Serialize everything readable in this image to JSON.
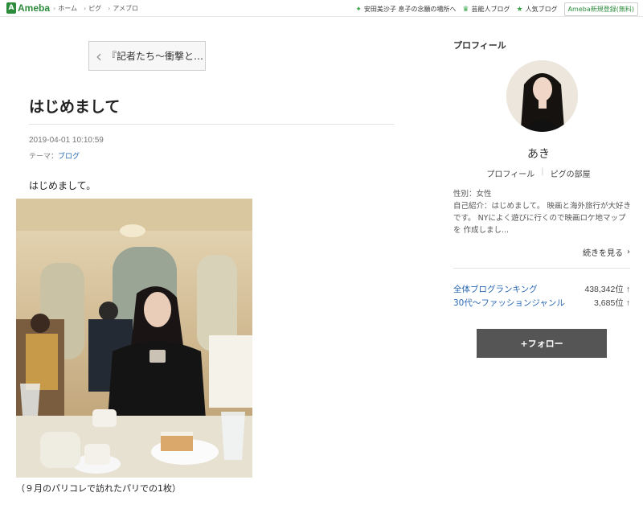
{
  "topbar": {
    "logo_text": "Ameba",
    "nav": [
      "ホーム",
      "ピグ",
      "アメブロ"
    ],
    "links": [
      {
        "icon": "sparkle-icon",
        "label": "安田美沙子 息子の念願の場所へ"
      },
      {
        "icon": "crown-icon",
        "label": "芸能人ブログ"
      },
      {
        "icon": "star-icon",
        "label": "人気ブログ"
      }
    ],
    "register_label": "Ameba新規登録(無料)"
  },
  "article": {
    "prev_label": "『記者たち〜衝撃と…",
    "title": "はじめまして",
    "date": "2019-04-01 10:10:59",
    "theme_prefix": "テーマ：",
    "theme": "ブログ",
    "intro": "はじめまして。",
    "caption": "（９月のパリコレで訪れたパリでの1枚）"
  },
  "profile": {
    "heading": "プロフィール",
    "name": "あき",
    "link_profile": "プロフィール",
    "link_room": "ピグの部屋",
    "gender": "性別：女性",
    "bio": "自己紹介：はじめまして。 映画と海外旅行が大好きです。 NYによく遊びに行くので映画ロケ地マップを 作成しまし...",
    "more_label": "続きを見る",
    "rankings": [
      {
        "label": "全体ブログランキング",
        "value": "438,342位"
      },
      {
        "label": "30代〜ファッションジャンル",
        "value": "3,685位"
      }
    ],
    "follow_label": "+フォロー"
  },
  "colors": {
    "brand": "#2d8c3c",
    "link": "#2a68b3",
    "follow_bg": "#555555"
  }
}
